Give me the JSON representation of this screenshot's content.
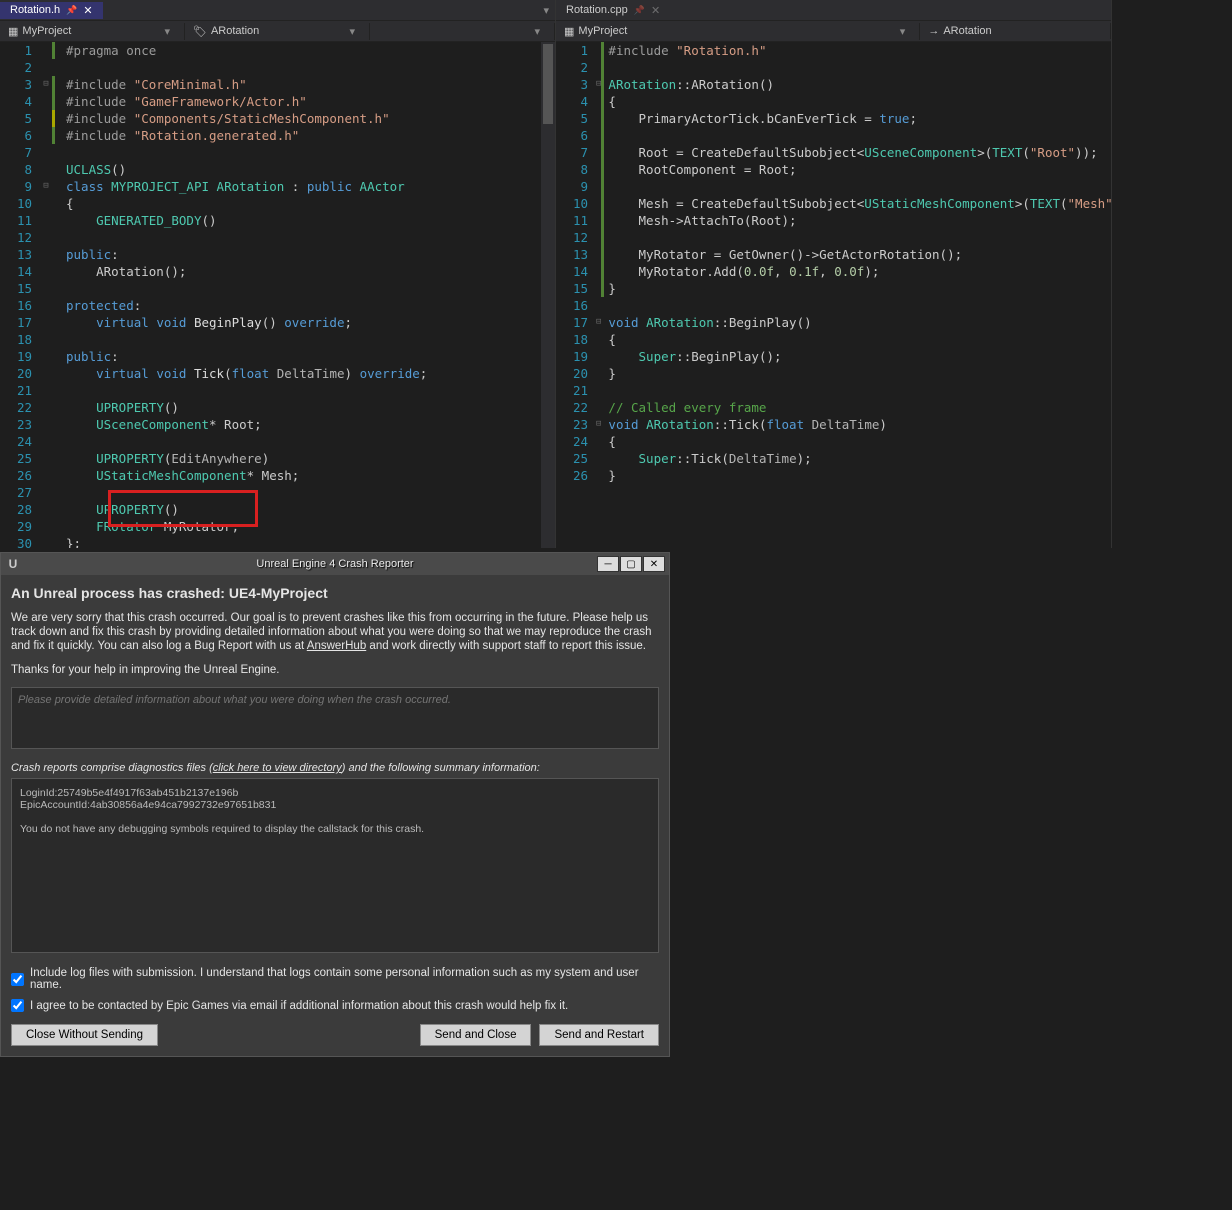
{
  "left": {
    "tab": "Rotation.h",
    "nav1": "MyProject",
    "nav2": "ARotation",
    "lines": [
      {
        "n": 1,
        "m": "g",
        "html": "<span class='pp'>#pragma once</span>"
      },
      {
        "n": 2,
        "m": "",
        "html": ""
      },
      {
        "n": 3,
        "m": "g",
        "fold": "⊟",
        "html": "<span class='pp'>#include </span><span class='str'>\"CoreMinimal.h\"</span>"
      },
      {
        "n": 4,
        "m": "g",
        "html": "<span class='pp'>#include </span><span class='str'>\"GameFramework/Actor.h\"</span>"
      },
      {
        "n": 5,
        "m": "y",
        "html": "<span class='pp'>#include </span><span class='str'>\"Components/StaticMeshComponent.h\"</span>"
      },
      {
        "n": 6,
        "m": "g",
        "html": "<span class='pp'>#include </span><span class='str'>\"Rotation.generated.h\"</span>"
      },
      {
        "n": 7,
        "m": "",
        "html": ""
      },
      {
        "n": 8,
        "m": "",
        "html": "<span class='cls'>UCLASS</span>()"
      },
      {
        "n": 9,
        "m": "",
        "fold": "⊟",
        "html": "<span class='kw'>class</span> <span class='cls'>MYPROJECT_API</span> <span class='cls'>ARotation</span> : <span class='kw'>public</span> <span class='cls'>AActor</span>"
      },
      {
        "n": 10,
        "m": "",
        "html": "{"
      },
      {
        "n": 11,
        "m": "",
        "html": "    <span class='cls'>GENERATED_BODY</span>()"
      },
      {
        "n": 12,
        "m": "",
        "html": ""
      },
      {
        "n": 13,
        "m": "",
        "html": "<span class='kw'>public</span>:"
      },
      {
        "n": 14,
        "m": "",
        "html": "    ARotation();"
      },
      {
        "n": 15,
        "m": "",
        "html": ""
      },
      {
        "n": 16,
        "m": "",
        "html": "<span class='kw'>protected</span>:"
      },
      {
        "n": 17,
        "m": "",
        "html": "    <span class='kw'>virtual</span> <span class='kw'>void</span> <span class='fn'>BeginPlay</span>() <span class='kw'>override</span>;"
      },
      {
        "n": 18,
        "m": "",
        "html": ""
      },
      {
        "n": 19,
        "m": "",
        "html": "<span class='kw'>public</span>:"
      },
      {
        "n": 20,
        "m": "",
        "html": "    <span class='kw'>virtual</span> <span class='kw'>void</span> <span class='fn'>Tick</span>(<span class='kw'>float</span> <span class='op'>DeltaTime</span>) <span class='kw'>override</span>;"
      },
      {
        "n": 21,
        "m": "",
        "html": ""
      },
      {
        "n": 22,
        "m": "",
        "html": "    <span class='cls'>UPROPERTY</span>()"
      },
      {
        "n": 23,
        "m": "",
        "html": "    <span class='cls'>USceneComponent</span>* Root;"
      },
      {
        "n": 24,
        "m": "",
        "html": ""
      },
      {
        "n": 25,
        "m": "",
        "html": "    <span class='cls'>UPROPERTY</span>(<span class='op'>EditAnywhere</span>)"
      },
      {
        "n": 26,
        "m": "",
        "html": "    <span class='cls'>UStaticMeshComponent</span>* Mesh;"
      },
      {
        "n": 27,
        "m": "",
        "html": ""
      },
      {
        "n": 28,
        "m": "",
        "html": "    <span class='cls'>UPROPERTY</span>()"
      },
      {
        "n": 29,
        "m": "",
        "html": "    <span class='cls'>FRotator</span> MyRotator;"
      },
      {
        "n": 30,
        "m": "",
        "html": "};"
      }
    ]
  },
  "right": {
    "tab": "Rotation.cpp",
    "nav1": "MyProject",
    "nav2": "ARotation",
    "lines": [
      {
        "n": 1,
        "m": "g",
        "html": "<span class='pp'>#include </span><span class='str'>\"Rotation.h\"</span>"
      },
      {
        "n": 2,
        "m": "g",
        "html": ""
      },
      {
        "n": 3,
        "m": "g",
        "fold": "⊟",
        "html": "<span class='cls'>ARotation</span>::ARotation()"
      },
      {
        "n": 4,
        "m": "g",
        "html": "{"
      },
      {
        "n": 5,
        "m": "g",
        "html": "    PrimaryActorTick.bCanEverTick = <span class='kw'>true</span>;"
      },
      {
        "n": 6,
        "m": "g",
        "html": ""
      },
      {
        "n": 7,
        "m": "g",
        "html": "    Root = CreateDefaultSubobject&lt;<span class='cls'>USceneComponent</span>&gt;(<span class='cls'>TEXT</span>(<span class='str'>\"Root\"</span>));"
      },
      {
        "n": 8,
        "m": "g",
        "html": "    RootComponent = Root;"
      },
      {
        "n": 9,
        "m": "g",
        "html": ""
      },
      {
        "n": 10,
        "m": "g",
        "html": "    Mesh = CreateDefaultSubobject&lt;<span class='cls'>UStaticMeshComponent</span>&gt;(<span class='cls'>TEXT</span>(<span class='str'>\"Mesh\"</span>));"
      },
      {
        "n": 11,
        "m": "g",
        "html": "    Mesh-&gt;AttachTo(Root);"
      },
      {
        "n": 12,
        "m": "g",
        "html": ""
      },
      {
        "n": 13,
        "m": "g",
        "html": "    MyRotator = GetOwner()-&gt;GetActorRotation();"
      },
      {
        "n": 14,
        "m": "g",
        "html": "    MyRotator.Add(<span class='num'>0.0f</span>, <span class='num'>0.1f</span>, <span class='num'>0.0f</span>);"
      },
      {
        "n": 15,
        "m": "g",
        "html": "}"
      },
      {
        "n": 16,
        "m": "",
        "html": ""
      },
      {
        "n": 17,
        "m": "",
        "fold": "⊟",
        "html": "<span class='kw'>void</span> <span class='cls'>ARotation</span>::BeginPlay()"
      },
      {
        "n": 18,
        "m": "",
        "html": "{"
      },
      {
        "n": 19,
        "m": "",
        "html": "    <span class='cls'>Super</span>::BeginPlay();"
      },
      {
        "n": 20,
        "m": "",
        "html": "}"
      },
      {
        "n": 21,
        "m": "",
        "html": ""
      },
      {
        "n": 22,
        "m": "",
        "html": "<span class='cmt'>// Called every frame</span>"
      },
      {
        "n": 23,
        "m": "",
        "fold": "⊟",
        "html": "<span class='kw'>void</span> <span class='cls'>ARotation</span>::Tick(<span class='kw'>float</span> <span class='op'>DeltaTime</span>)"
      },
      {
        "n": 24,
        "m": "",
        "html": "{"
      },
      {
        "n": 25,
        "m": "",
        "html": "    <span class='cls'>Super</span>::Tick(<span class='op'>DeltaTime</span>);"
      },
      {
        "n": 26,
        "m": "",
        "html": "}"
      }
    ]
  },
  "crash": {
    "title": "Unreal Engine 4 Crash Reporter",
    "heading": "An Unreal process has crashed: UE4-MyProject",
    "p1a": "We are very sorry that this crash occurred. Our goal is to prevent crashes like this from occurring in the future. Please help us track down and fix this crash by providing detailed information about what you were doing so that we may reproduce the crash and fix it quickly. You can also log a Bug Report with us at ",
    "p1link": "AnswerHub",
    "p1b": " and work directly with support staff to report this issue.",
    "p2": "Thanks for your help in improving the Unreal Engine.",
    "placeholder": "Please provide detailed information about what you were doing when the crash occurred.",
    "diagLabelA": "Crash reports comprise diagnostics files (",
    "diagLink": "click here to view directory",
    "diagLabelB": ") and the following summary information:",
    "diagLine1": "LoginId:25749b5e4f4917f63ab451b2137e196b",
    "diagLine2": "EpicAccountId:4ab30856a4e94ca7992732e97651b831",
    "diagLine3": "You do not have any debugging symbols required to display the callstack for this crash.",
    "chk1": "Include log files with submission. I understand that logs contain some personal information such as my system and user name.",
    "chk2": "I agree to be contacted by Epic Games via email if additional information about this crash would help fix it.",
    "btn1": "Close Without Sending",
    "btn2": "Send and Close",
    "btn3": "Send and Restart"
  }
}
